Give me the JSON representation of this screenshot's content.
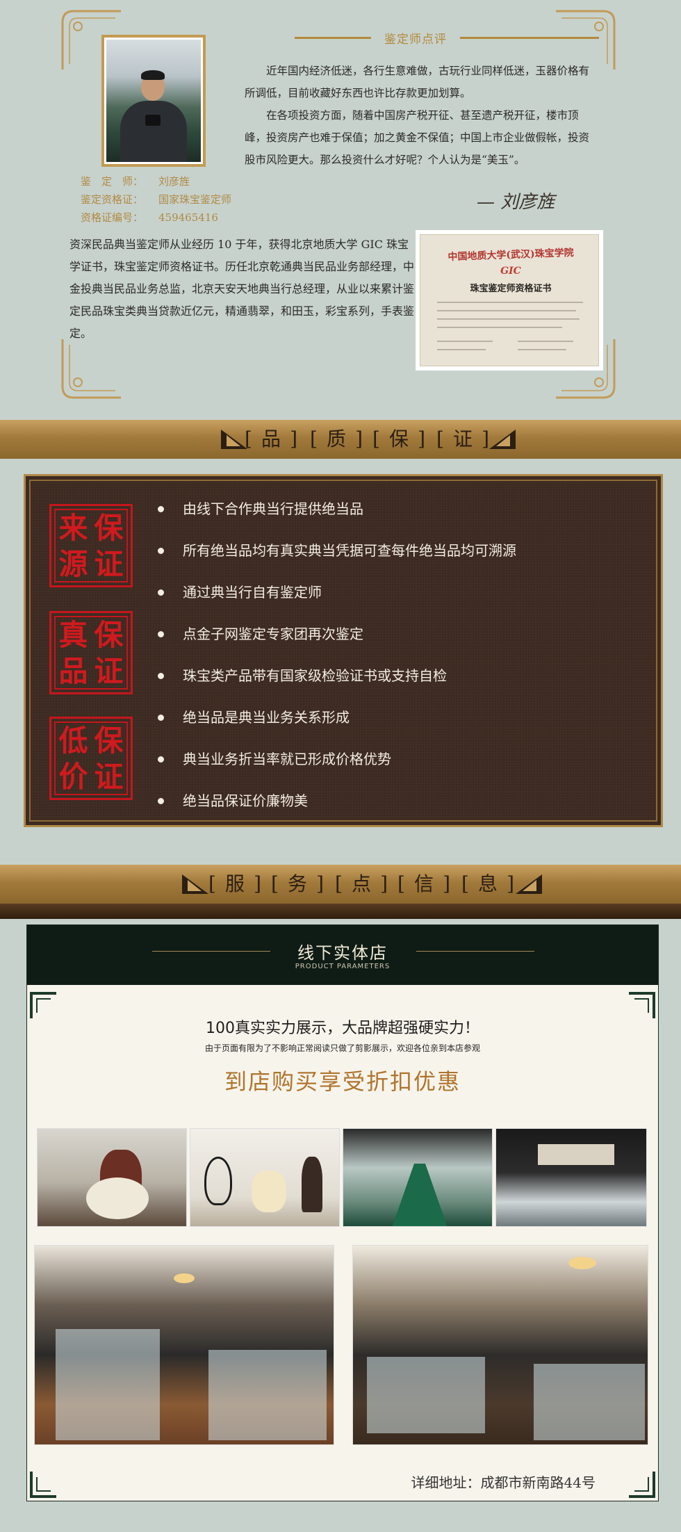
{
  "appraiser": {
    "review_title": "鉴定师点评",
    "info": [
      {
        "key": "鉴　定　师：",
        "value": "刘彦旌"
      },
      {
        "key": "鉴定资格证：",
        "value": "国家珠宝鉴定师"
      },
      {
        "key": "资格证编号：",
        "value": "459465416"
      }
    ],
    "review_paragraphs": [
      "近年国内经济低迷，各行生意难做，古玩行业同样低迷，玉器价格有所调低，目前收藏好东西也许比存款更加划算。",
      "在各项投资方面，随着中国房产税开征、甚至遗产税开征，楼市顶峰，投资房产也难于保值；加之黄金不保值；中国上市企业做假帐，投资股市风险更大。那么投资什么才好呢？个人认为是“美玉”。"
    ],
    "signature": "— 刘彦旌",
    "bio": "资深民品典当鉴定师从业经历 10 于年，获得北京地质大学 GIC 珠宝学证书，珠宝鉴定师资格证书。历任北京乾通典当民品业务部经理，中金投典当民品业务总监，北京天安天地典当行总经理，从业以来累计鉴定民品珠宝类典当贷款近亿元，精通翡翠，和田玉，彩宝系列，手表鉴定。",
    "certificate": {
      "line1": "中国地质大学(武汉)珠宝学院",
      "line2": "GIC",
      "line3": "珠宝鉴定师资格证书"
    }
  },
  "quality_banner": [
    "品",
    "质",
    "保",
    "证"
  ],
  "seals": [
    [
      "来",
      "保",
      "源",
      "证"
    ],
    [
      "真",
      "保",
      "品",
      "证"
    ],
    [
      "低",
      "保",
      "价",
      "证"
    ]
  ],
  "guarantee_items": [
    "由线下合作典当行提供绝当品",
    "所有绝当品均有真实典当凭据可查每件绝当品均可溯源",
    "通过典当行自有鉴定师",
    "点金子网鉴定专家团再次鉴定",
    "珠宝类产品带有国家级检验证书或支持自检",
    "绝当品是典当业务关系形成",
    "典当业务折当率就已形成价格优势",
    "绝当品保证价廉物美"
  ],
  "service_banner": [
    "服",
    "务",
    "点",
    "信",
    "息"
  ],
  "stores": {
    "title": "线下实体店",
    "subtitle": "PRODUCT PARAMETERS",
    "headline": "100真实实力展示，大品牌超强硬实力！",
    "subline": "由于页面有限为了不影响正常阅读只做了剪影展示，欢迎各位亲到本店参观",
    "promo": "到店购买享受折扣优惠",
    "address": "详细地址：成都市新南路44号"
  },
  "colors": {
    "page_bg": "#c7d2cd",
    "gold": "#b08a48",
    "seal_red": "#c4161c",
    "panel_brown": "#3d2a21",
    "store_dark": "#0f1c15"
  }
}
